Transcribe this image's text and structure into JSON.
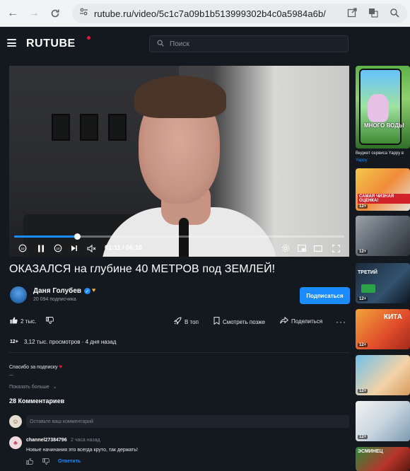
{
  "browser": {
    "url": "rutube.ru/video/5c1c7a09b1b513999302b4c0a5984a6b/",
    "back_icon": "←",
    "forward_icon": "→"
  },
  "header": {
    "logo": "RUTUBE",
    "search_placeholder": "Поиск"
  },
  "player": {
    "time": "01:11 / 06:10",
    "progress_fraction": 0.19
  },
  "video": {
    "title": "ОКАЗАЛСЯ на глубине 40 МЕТРОВ под ЗЕМЛЕЙ!",
    "channel_name": "Даня Голубев",
    "subscribers": "20 094 подписчика",
    "subscribe_label": "Подписаться",
    "likes": "2 тыс.",
    "top_label": "В топ",
    "watch_later_label": "Смотреть позже",
    "share_label": "Поделиться",
    "age_rating": "12+",
    "views": "3,12 тыс. просмотров · 4 дня назад",
    "description": "Спасибо за подписку",
    "description_more": "...",
    "show_more_label": "Показать больше"
  },
  "comments": {
    "title": "28 Комментариев",
    "input_placeholder": "Оставьте ваш комментарий",
    "items": [
      {
        "author": "channel27384796",
        "time": "2 часа назад",
        "text": "Новые начинания это всегда круто, так держать!",
        "reply_label": "Ответить"
      }
    ]
  },
  "sidebar": {
    "widget_title": "Виджет сервиса Yappy в",
    "widget_source": "Yappy",
    "first_card_overlay": "МНОГО ВОДЫ",
    "cards": [
      {
        "overlay": "САМАЯ ЧИЗНАЯ ОЦЕНКА!",
        "age": "12+"
      },
      {
        "overlay": "",
        "age": "12+"
      },
      {
        "overlay": "ТРЕТИЙ",
        "age": "12+"
      },
      {
        "overlay": "КИТА",
        "age": "12+"
      },
      {
        "overlay": "",
        "age": "12+"
      },
      {
        "overlay": "",
        "age": "12+"
      },
      {
        "overlay": "ЭСМИНЕЦ",
        "age": ""
      }
    ]
  },
  "colors": {
    "accent": "#1a8cff",
    "background": "#14191f",
    "brand_red": "#ed143b"
  }
}
